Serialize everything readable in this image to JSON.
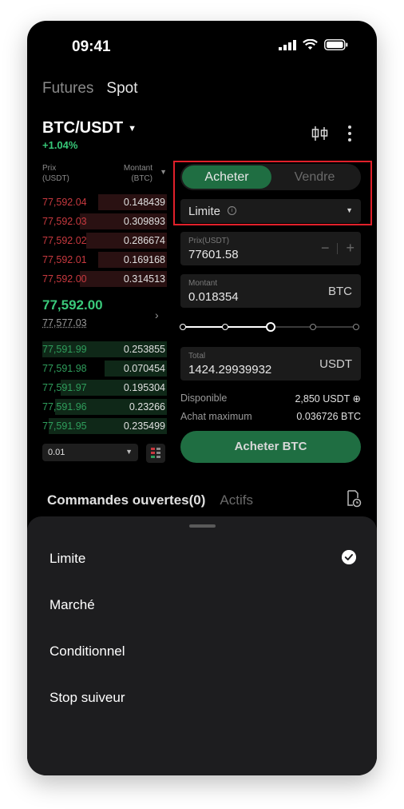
{
  "status_bar": {
    "time": "09:41"
  },
  "top_tabs": [
    {
      "label": "Futures"
    },
    {
      "label": "Spot"
    }
  ],
  "pair": {
    "symbol": "BTC/USDT",
    "change": "+1.04%"
  },
  "order_book": {
    "price_header": "Prix\n(USDT)",
    "amount_header": "Montant\n(BTC)",
    "asks": [
      {
        "price": "77,592.04",
        "qty": "0.148439",
        "depth": 0.55
      },
      {
        "price": "77,592.03",
        "qty": "0.309893",
        "depth": 0.7
      },
      {
        "price": "77,592.02",
        "qty": "0.286674",
        "depth": 0.65
      },
      {
        "price": "77,592.01",
        "qty": "0.169168",
        "depth": 0.55
      },
      {
        "price": "77,592.00",
        "qty": "0.314513",
        "depth": 0.7
      }
    ],
    "mid_price": "77,592.00",
    "mid_ref": "77,577.03",
    "bids": [
      {
        "price": "77,591.99",
        "qty": "0.253855",
        "depth": 1.0
      },
      {
        "price": "77,591.98",
        "qty": "0.070454",
        "depth": 0.5
      },
      {
        "price": "77,591.97",
        "qty": "0.195304",
        "depth": 0.85
      },
      {
        "price": "77,591.96",
        "qty": "0.23266",
        "depth": 0.9
      },
      {
        "price": "77,591.95",
        "qty": "0.235499",
        "depth": 0.95
      }
    ],
    "depth_select": "0.01"
  },
  "trade_form": {
    "buy_label": "Acheter",
    "sell_label": "Vendre",
    "order_type": "Limite",
    "price_label": "Prix(USDT)",
    "price_value": "77601.58",
    "amount_label": "Montant",
    "amount_value": "0.018354",
    "amount_unit": "BTC",
    "slider_percent": 50,
    "total_label": "Total",
    "total_value": "1424.29939932",
    "total_unit": "USDT",
    "available_label": "Disponible",
    "available_value": "2,850 USDT",
    "max_buy_label": "Achat maximum",
    "max_buy_value": "0.036726 BTC",
    "submit_label": "Acheter BTC"
  },
  "orders_tabs": [
    {
      "label": "Commandes ouvertes(0)"
    },
    {
      "label": "Actifs"
    }
  ],
  "sheet": {
    "options": [
      {
        "label": "Limite",
        "selected": true
      },
      {
        "label": "Marché",
        "selected": false
      },
      {
        "label": "Conditionnel",
        "selected": false
      },
      {
        "label": "Stop suiveur",
        "selected": false
      }
    ]
  },
  "colors": {
    "buy_green": "#1f6e42",
    "ask_red": "#c8393f",
    "bid_green": "#2f9e5c",
    "highlight_box": "#e0202a"
  }
}
